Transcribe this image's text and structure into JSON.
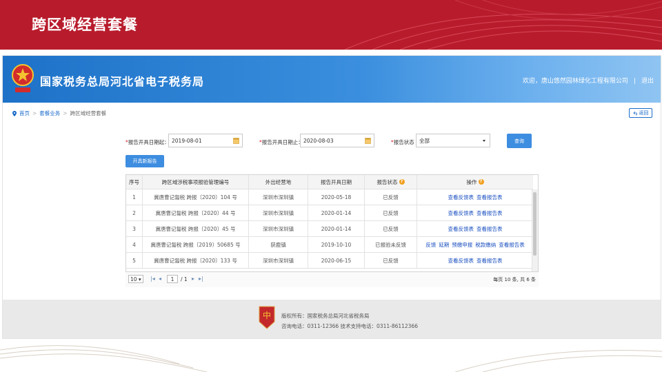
{
  "slide": {
    "title": "跨区域经营套餐"
  },
  "header": {
    "site_title": "国家税务总局河北省电子税务局",
    "welcome": "欢迎，唐山悠然园林绿化工程有限公司",
    "separator": "|",
    "logout": "退出"
  },
  "breadcrumb": {
    "home": "首页",
    "sep1": ">",
    "level2": "套餐业务",
    "sep2": ">",
    "current": "跨区域经营套餐"
  },
  "back_label": "返回",
  "filters": {
    "start_label": "报告开具日期起：",
    "start_value": "2019-08-01",
    "end_label": "报告开具日期止：",
    "end_value": "2020-08-03",
    "status_label": "报告状态",
    "status_value": "全部",
    "query_label": "查询",
    "required_mark": "*"
  },
  "new_report_label": "开具新报告",
  "table": {
    "headers": [
      "序号",
      "跨区域涉税事项报验管理编号",
      "外出经营地",
      "报告开具日期",
      "报告状态",
      "操作"
    ],
    "rows": [
      {
        "no": "1",
        "code": "冀唐曹记匐税 跨报〔2020〕104 号",
        "place": "深圳市深圳镇",
        "date": "2020-05-18",
        "status": "已反馈",
        "ops": [
          "查看反馈表",
          "查看报告表"
        ]
      },
      {
        "no": "2",
        "code": "冀唐曹记匐税 跨报〔2020〕44 号",
        "place": "深圳市深圳镇",
        "date": "2020-01-14",
        "status": "已反馈",
        "ops": [
          "查看反馈表",
          "查看报告表"
        ]
      },
      {
        "no": "3",
        "code": "冀唐曹记匐税 跨报〔2020〕45 号",
        "place": "深圳市深圳镇",
        "date": "2020-01-14",
        "status": "已反馈",
        "ops": [
          "查看反馈表",
          "查看报告表"
        ]
      },
      {
        "no": "4",
        "code": "冀唐曹记匐税 跨报〔2019〕50685 号",
        "place": "获鹿镇",
        "date": "2019-10-10",
        "status": "已报验未反馈",
        "ops": [
          "反馈",
          "延期",
          "预缴申报",
          "税款缴纳",
          "查看报告表"
        ]
      },
      {
        "no": "5",
        "code": "冀唐曹记匐税 跨报〔2020〕133 号",
        "place": "深圳市深圳镇",
        "date": "2020-06-15",
        "status": "已反馈",
        "ops": [
          "查看反馈表",
          "查看报告表"
        ]
      }
    ]
  },
  "pager": {
    "page_size": "10",
    "current_page": "1",
    "total_pages": "/ 1",
    "info": "每页 10 条, 共 6 条"
  },
  "footer": {
    "line1": "版权所有：国家税务总局河北省税务局",
    "line2": "咨询电话：0311-12366  技术支持电话：0311-86112366"
  },
  "colors": {
    "banner_red": "#b81c2c",
    "header_blue": "#1d72c8",
    "button_blue": "#3d8de0",
    "link_blue": "#1a4fc0"
  },
  "icons": [
    "location-pin-icon",
    "back-arrow-icon",
    "calendar-icon",
    "dropdown-caret-icon",
    "help-icon",
    "tax-emblem-icon",
    "badge-logo-icon"
  ]
}
